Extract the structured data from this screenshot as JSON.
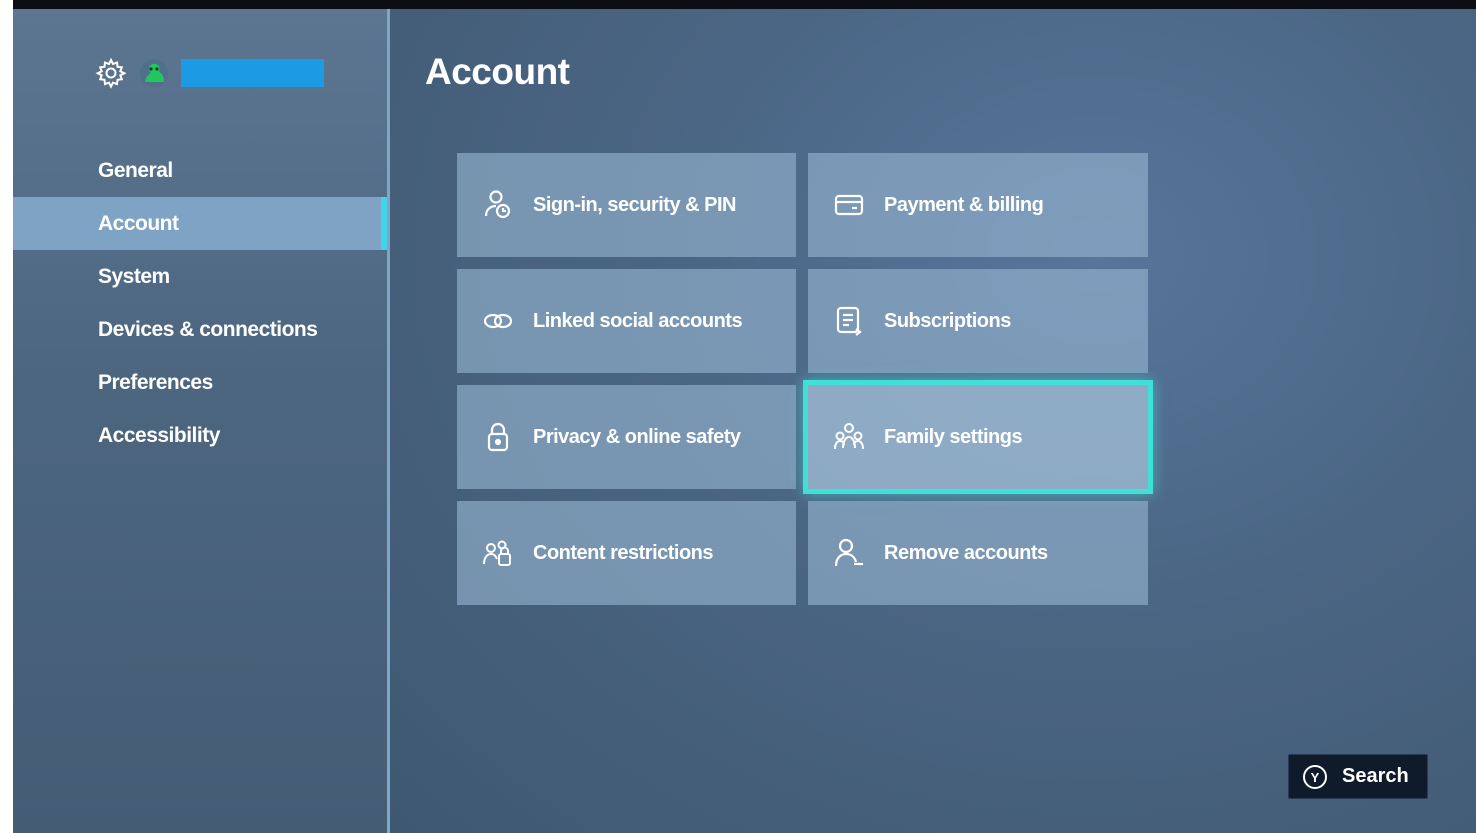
{
  "sidebar": {
    "items": [
      {
        "label": "General"
      },
      {
        "label": "Account"
      },
      {
        "label": "System"
      },
      {
        "label": "Devices & connections"
      },
      {
        "label": "Preferences"
      },
      {
        "label": "Accessibility"
      }
    ],
    "active": "Account",
    "gamertag_color": "#1c9ae3"
  },
  "main": {
    "title": "Account",
    "tiles": [
      {
        "label": "Sign-in, security & PIN",
        "icon": "key-person-icon"
      },
      {
        "label": "Payment & billing",
        "icon": "credit-card-icon"
      },
      {
        "label": "Linked social accounts",
        "icon": "link-icon"
      },
      {
        "label": "Subscriptions",
        "icon": "subscriptions-icon"
      },
      {
        "label": "Privacy & online safety",
        "icon": "lock-icon"
      },
      {
        "label": "Family settings",
        "icon": "family-icon"
      },
      {
        "label": "Content restrictions",
        "icon": "content-restrictions-icon"
      },
      {
        "label": "Remove accounts",
        "icon": "remove-person-icon"
      }
    ],
    "focused": "Family settings"
  },
  "footer": {
    "search_label": "Search",
    "search_button_glyph": "Y"
  },
  "colors": {
    "accent": "#3fd4e6",
    "focus_ring": "#3fe0d6"
  }
}
